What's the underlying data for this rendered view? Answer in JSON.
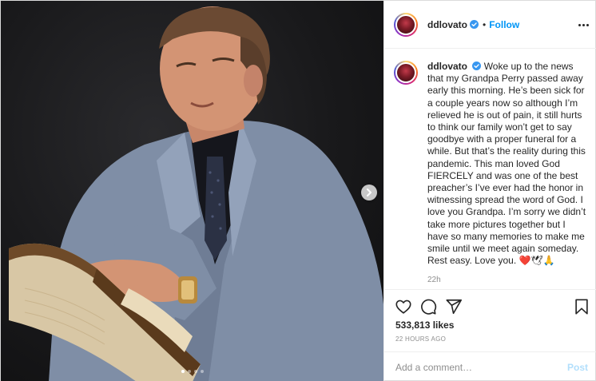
{
  "post": {
    "username": "ddlovato",
    "verified": true,
    "separator": "•",
    "follow_label": "Follow",
    "caption_text": "Woke up to the news that my Grandpa Perry passed away early this morning. He’s been sick for a couple years now so although I’m relieved he is out of pain, it still hurts to think our family won’t get to say goodbye with a proper funeral for a while. But that’s the reality during this pandemic. This man loved God FIERCELY and was one of the best preacher’s I’ve ever had the honor in witnessing spread the word of God. I love you Grandpa. I’m sorry we didn’t take more pictures together but I have so many memories to make me smile until we meet again someday. Rest easy. Love you. ❤️🕊🙏",
    "caption_age": "22h",
    "likes": "533,813 likes",
    "posted_time": "22 HOURS AGO",
    "carousel": {
      "count": 4,
      "active": 0
    }
  },
  "comment": {
    "placeholder": "Add a comment…",
    "post_label": "Post"
  },
  "icons": {
    "more": "more-options-icon",
    "like": "heart-icon",
    "comment": "comment-icon",
    "share": "share-icon",
    "save": "bookmark-icon",
    "next": "chevron-right-icon",
    "verified": "verified-badge-icon"
  },
  "colors": {
    "link_blue": "#0095f6",
    "post_disabled": "#b2dffc",
    "secondary_text": "#8e8e8e"
  }
}
